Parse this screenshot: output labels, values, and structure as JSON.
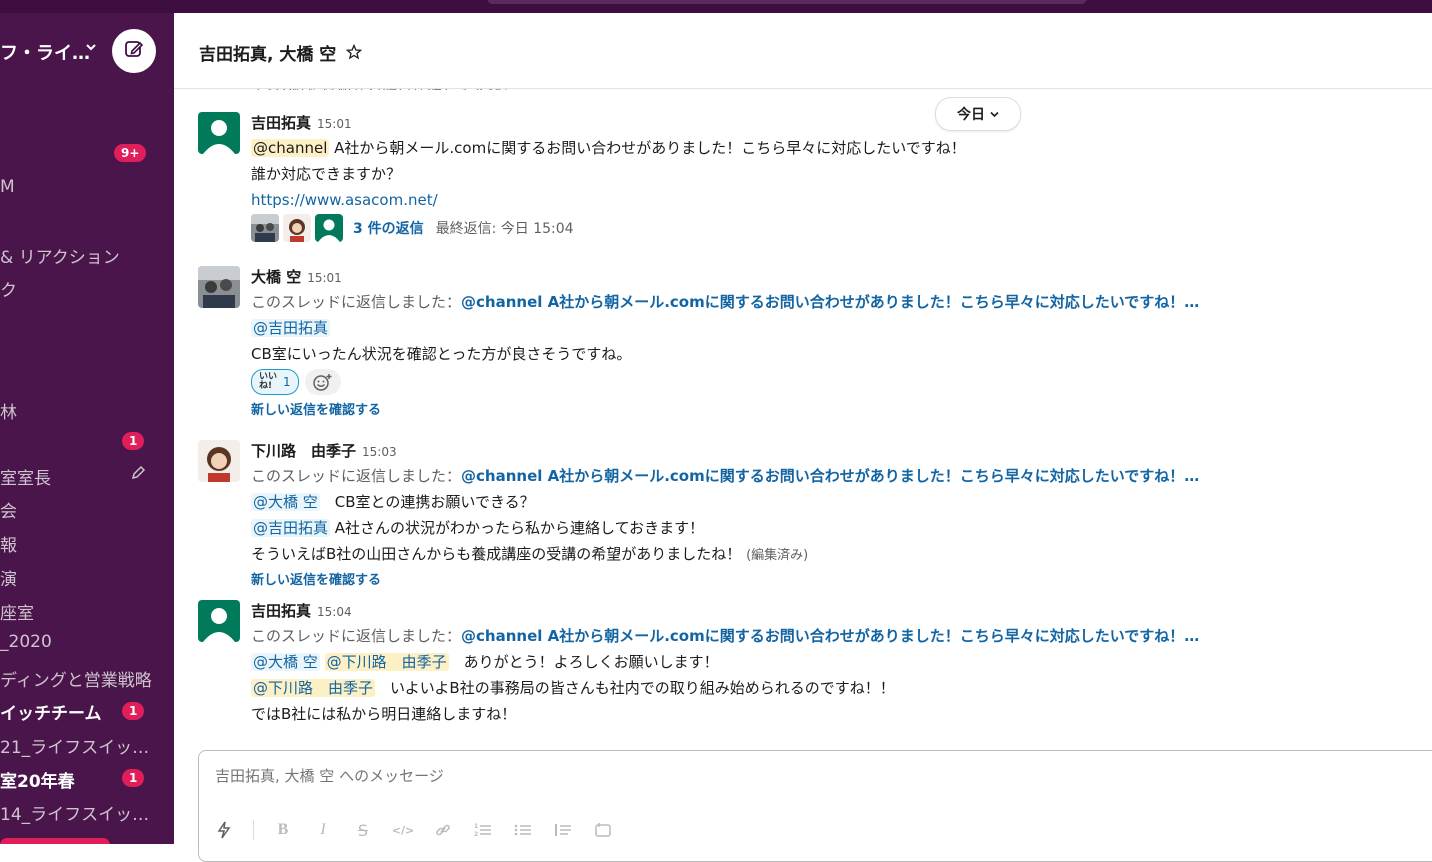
{
  "workspace": {
    "name": "フ・ライ…"
  },
  "sidebar": {
    "items": [
      {
        "label": "M",
        "bold": false
      },
      {
        "label": "& リアクション",
        "bold": false
      },
      {
        "label": "ク",
        "bold": false
      },
      {
        "label": "林",
        "bold": false
      },
      {
        "label": "室室長",
        "bold": false
      },
      {
        "label": "会",
        "bold": false
      },
      {
        "label": "報",
        "bold": false
      },
      {
        "label": "演",
        "bold": false
      },
      {
        "label": "座室",
        "bold": false
      },
      {
        "label": "_2020",
        "bold": false
      },
      {
        "label": "ディングと営業戦略",
        "bold": false
      },
      {
        "label": "イッチチーム",
        "bold": true
      },
      {
        "label": "21_ライフスイッ…",
        "bold": false
      },
      {
        "label": "室20年春",
        "bold": true
      },
      {
        "label": "14_ライフスイッ…",
        "bold": false
      }
    ],
    "badges": [
      "9+",
      "1",
      "1",
      "1"
    ]
  },
  "channel": {
    "title": "吉田拓真, 大橋 空"
  },
  "cutoff_text": "ではB社には私から明日連絡しますね！",
  "date_divider": "今日",
  "messages": [
    {
      "author": "吉田拓真",
      "time": "15:01",
      "mention": "@channel",
      "text1": "A社から朝メール.comに関するお問い合わせがありました！こちら早々に対応したいですね！",
      "text2": "誰か対応できますか？",
      "link": "https://www.asacom.net/",
      "thread_count": "3 件の返信",
      "thread_last": "最終返信: 今日 15:04"
    },
    {
      "author": "大橋 空",
      "time": "15:01",
      "reply_prefix": "このスレッドに返信しました：",
      "reply_ref": "@channel A社から朝メール.comに関するお問い合わせがありました！こちら早々に対応したいですね！…",
      "mention": "@吉田拓真",
      "text": "CB室にいったん状況を確認とった方が良さそうですね。",
      "reaction_emoji": "いいね!",
      "reaction_count": "1",
      "new_replies": "新しい返信を確認する"
    },
    {
      "author": "下川路　由季子",
      "time": "15:03",
      "reply_prefix": "このスレッドに返信しました：",
      "reply_ref": "@channel A社から朝メール.comに関するお問い合わせがありました！こちら早々に対応したいですね！…",
      "mention1": "@大橋 空",
      "text1": "CB室との連携お願いできる？",
      "mention2": "@吉田拓真",
      "text2": "A社さんの状況がわかったら私から連絡しておきます！",
      "text3": "そういえばB社の山田さんからも養成講座の受講の希望がありましたね！",
      "edited": "(編集済み)",
      "new_replies": "新しい返信を確認する"
    },
    {
      "author": "吉田拓真",
      "time": "15:04",
      "reply_prefix": "このスレッドに返信しました：",
      "reply_ref": "@channel A社から朝メール.comに関するお問い合わせがありました！こちら早々に対応したいですね！…",
      "mention1": "@大橋 空",
      "mention2": "@下川路　由季子",
      "text1": "ありがとう！よろしくお願いします！",
      "mention3": "@下川路　由季子",
      "text2": "いよいよB社の事務局の皆さんも社内での取り組み始められるのですね！！",
      "text3": "ではB社には私から明日連絡しますね！"
    }
  ],
  "composer": {
    "placeholder": "吉田拓真, 大橋 空 へのメッセージ"
  },
  "icons": {
    "compose": "compose-icon",
    "star": "star-icon",
    "pencil": "pencil-icon",
    "add_reaction": "add-reaction-icon",
    "toolbar": [
      "shortcuts-icon",
      "bold-icon",
      "italic-icon",
      "strikethrough-icon",
      "code-icon",
      "link-icon",
      "ordered-list-icon",
      "bulleted-list-icon",
      "blockquote-icon",
      "code-block-icon"
    ]
  },
  "colors": {
    "sidebar": "#4a154b",
    "topbar": "#3f0e40",
    "badge": "#e01e5a",
    "link": "#1264a3",
    "mention_bg": "#e8f5fa",
    "mention_yellow": "#fdf0c5"
  }
}
